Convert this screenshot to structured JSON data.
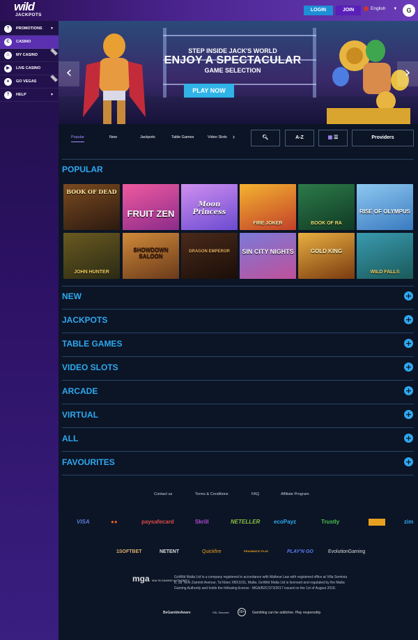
{
  "header": {
    "logo_top": "wild",
    "logo_bottom": "JACKPOTS",
    "login": "LOGIN",
    "join": "JOIN",
    "language": "English",
    "avatar": "G"
  },
  "sidebar": {
    "items": [
      {
        "label": "PROMOTIONS",
        "icon": "?"
      },
      {
        "label": "CASINO",
        "icon": "C"
      },
      {
        "label": "MY CASINO",
        "icon": "☺"
      },
      {
        "label": "LIVE CASINO",
        "icon": "▶"
      },
      {
        "label": "GO VEGAS",
        "icon": "♠"
      },
      {
        "label": "HELP",
        "icon": "?"
      }
    ],
    "badge": "NEW"
  },
  "hero": {
    "sub": "STEP INSIDE JACK'S WORLD",
    "title": "ENJOY A SPECTACULAR",
    "sel": "GAME SELECTION",
    "cta": "PLAY NOW"
  },
  "filters": {
    "tabs": [
      "Popular",
      "New",
      "Jackpots",
      "Table Games",
      "Video Slots"
    ],
    "az": "A-Z",
    "providers": "Providers"
  },
  "popular": {
    "title": "POPULAR",
    "games": [
      "BOOK OF DEAD",
      "FRUIT ZEN",
      "Moon Princess",
      "FIRE JOKER",
      "BOOK OF RA",
      "RISE OF OLYMPUS",
      "JOHN HUNTER",
      "SHOWDOWN SALOON",
      "DRAGON EMPEROR",
      "SIN CITY NIGHTS",
      "GOLD KING",
      "WILD FALLS"
    ]
  },
  "categories": [
    "NEW",
    "JACKPOTS",
    "TABLE GAMES",
    "VIDEO SLOTS",
    "ARCADE",
    "VIRTUAL",
    "ALL",
    "FAVOURITES"
  ],
  "footer": {
    "links": [
      "Contact us",
      "Terms & Conditions",
      "FAQ",
      "Affiliate Program"
    ],
    "payments": [
      "VISA",
      "●●",
      "paysafecard",
      "Skrill",
      "NETELLER",
      "ecoPayz",
      "Trustly",
      "",
      "zim"
    ],
    "providers": [
      "1SOFTBET",
      "NETENT",
      "Quickfire",
      "PRAGMATIC PLAY",
      "PLAY'N GO",
      "EvolutionGaming"
    ],
    "mga": "mga",
    "mga_small": "MALTA GAMING AUTHORITY",
    "legal": "GoWild Malta Ltd is a company registered in accordance with Maltese Law with registered office at Villa Seminia 8, Sir Temi Zammit Avenue, Ta'Xbiex XBX1011, Malta. GoWild Malta Ltd is licensed and regulated by the Malta Gaming Authority and holds the following license - MGA/B2C/373/2017 issued on the 1st of August 2018.",
    "begamble": "BeGambleAware",
    "ssl": "SSL Secured",
    "age": "18+",
    "addictive": "Gambling can be addictive. Play responsibly."
  }
}
